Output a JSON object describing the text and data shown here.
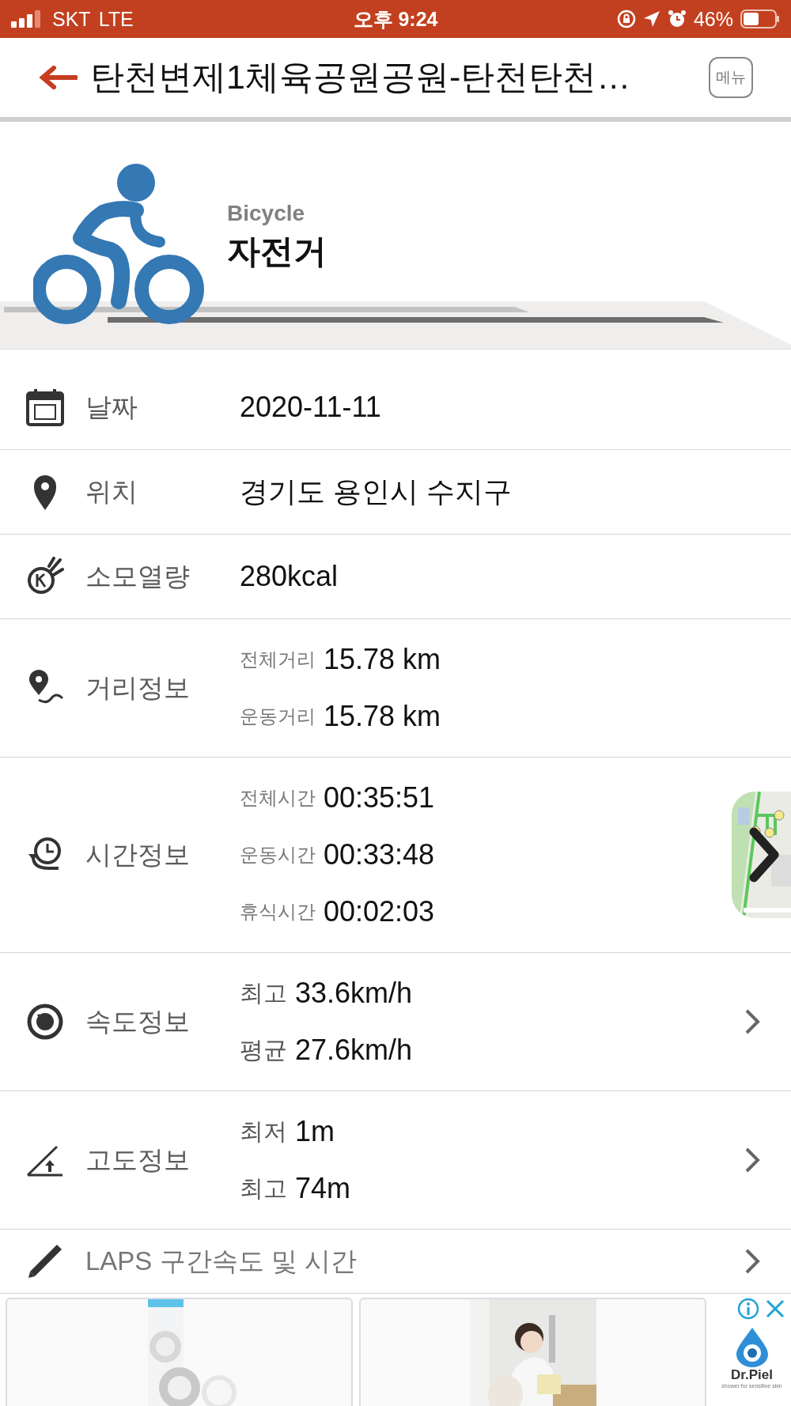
{
  "status_bar": {
    "carrier": "SKT",
    "network": "LTE",
    "time": "오후 9:24",
    "battery": "46%"
  },
  "header": {
    "title": "탄천변제1체육공원공원-탄천탄천…",
    "menu_button": "메뉴"
  },
  "activity": {
    "subtitle": "Bicycle",
    "name": "자전거"
  },
  "rows": [
    {
      "kind": "plain",
      "label": "날짜",
      "values": [
        {
          "value": "2020-11-11"
        }
      ]
    },
    {
      "kind": "plain",
      "label": "위치",
      "values": [
        {
          "value": "경기도 용인시 수지구"
        }
      ]
    },
    {
      "kind": "plain",
      "label": "소모열량",
      "values": [
        {
          "value": "280kcal"
        }
      ]
    },
    {
      "kind": "plain",
      "label": "거리정보",
      "values": [
        {
          "label": "전체거리",
          "value": "15.78 km"
        },
        {
          "label": "운동거리",
          "value": "15.78 km"
        }
      ]
    },
    {
      "kind": "map",
      "label": "시간정보",
      "values": [
        {
          "label": "전체시간",
          "value": "00:35:51"
        },
        {
          "label": "운동시간",
          "value": "00:33:48"
        },
        {
          "label": "휴식시간",
          "value": "00:02:03"
        }
      ]
    },
    {
      "kind": "link",
      "label": "속도정보",
      "values": [
        {
          "label": "최고",
          "value": "33.6km/h"
        },
        {
          "label": "평균",
          "value": "27.6km/h"
        }
      ]
    },
    {
      "kind": "link",
      "label": "고도정보",
      "values": [
        {
          "label": "최저",
          "value": "1m"
        },
        {
          "label": "최고",
          "value": "74m"
        }
      ]
    },
    {
      "kind": "link",
      "label": "LAPS 구간속도 및 시간"
    }
  ],
  "ad": {
    "brand": "Dr.Piel",
    "tagline": "shower for sensitive skin"
  }
}
